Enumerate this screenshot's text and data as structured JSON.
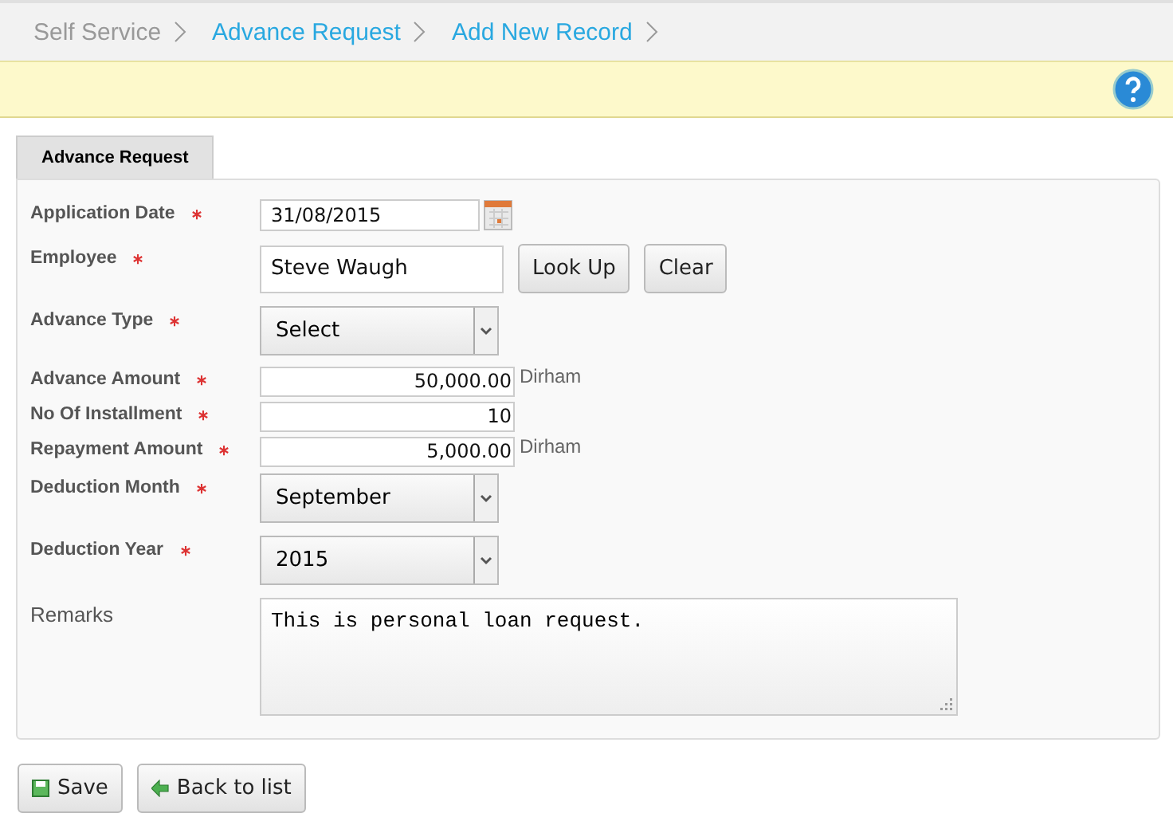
{
  "breadcrumb": [
    {
      "label": "Self Service",
      "kind": "plain"
    },
    {
      "label": "Advance Request",
      "kind": "link"
    },
    {
      "label": "Add New Record",
      "kind": "link"
    }
  ],
  "tabs": [
    {
      "label": "Advance Request",
      "selected": true
    }
  ],
  "fields": [
    {
      "label": "Application Date",
      "required": true,
      "kind": "date",
      "value": "31/08/2015"
    },
    {
      "label": "Employee",
      "required": true,
      "kind": "lookup",
      "value": "Steve Waugh",
      "buttons": [
        "Look Up",
        "Clear"
      ]
    },
    {
      "label": "Advance Type",
      "required": true,
      "kind": "select",
      "value": "Select"
    },
    {
      "label": "Advance Amount",
      "required": true,
      "kind": "amount",
      "value": "50,000.00",
      "unit": "Dirham"
    },
    {
      "label": "No Of Installment",
      "required": true,
      "kind": "amount",
      "value": "10"
    },
    {
      "label": "Repayment Amount",
      "required": true,
      "kind": "amount",
      "value": "5,000.00",
      "unit": "Dirham"
    },
    {
      "label": "Deduction Month",
      "required": true,
      "kind": "select",
      "value": "September"
    },
    {
      "label": "Deduction Year",
      "required": true,
      "kind": "select",
      "value": "2015"
    },
    {
      "label": "Remarks",
      "required": false,
      "kind": "textarea",
      "value": "This is personal loan request."
    }
  ],
  "actions": [
    {
      "label": "Save",
      "kind": "save"
    },
    {
      "label": "Back to list",
      "kind": "back"
    }
  ]
}
